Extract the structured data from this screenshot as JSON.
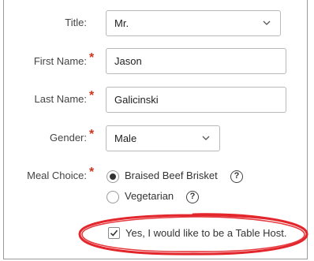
{
  "form": {
    "title": {
      "label": "Title:",
      "value": "Mr."
    },
    "first_name": {
      "label": "First Name:",
      "value": "Jason",
      "required": "*"
    },
    "last_name": {
      "label": "Last Name:",
      "value": "Galicinski",
      "required": "*"
    },
    "gender": {
      "label": "Gender:",
      "value": "Male",
      "required": "*"
    },
    "meal_choice": {
      "label": "Meal Choice:",
      "required": "*",
      "options": [
        {
          "label": "Braised Beef Brisket",
          "selected": true,
          "help": "?"
        },
        {
          "label": "Vegetarian",
          "selected": false,
          "help": "?"
        }
      ]
    },
    "table_host": {
      "label": "Yes, I would like to be a Table Host.",
      "checked": true
    }
  },
  "colors": {
    "required_asterisk": "#d0341f",
    "highlight_circle": "#e3262b",
    "border": "#b9b9b9"
  },
  "icons": {
    "select_chevron": "chevron-down-icon",
    "help": "question-circle-icon",
    "check": "checkmark-icon"
  }
}
